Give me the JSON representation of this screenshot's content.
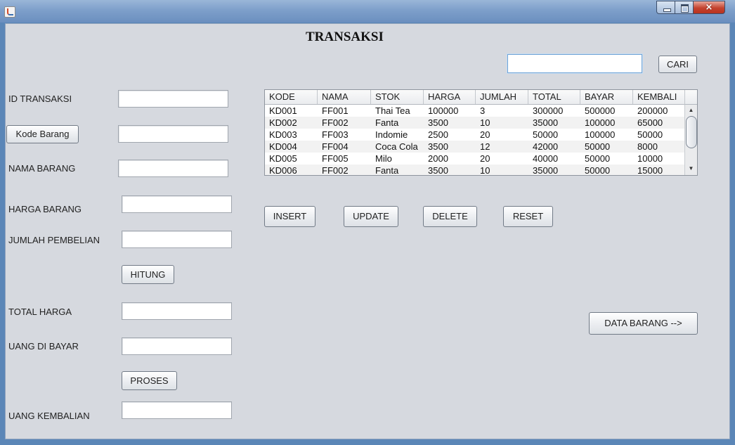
{
  "window": {
    "title": "",
    "close_glyph": "×"
  },
  "page": {
    "title": "TRANSAKSI"
  },
  "search": {
    "value": "",
    "button_label": "CARI"
  },
  "form": {
    "id_transaksi_label": "ID TRANSAKSI",
    "kode_barang_button": "Kode Barang",
    "nama_barang_label": "NAMA BARANG",
    "harga_barang_label": "HARGA BARANG",
    "jumlah_pembelian_label": "JUMLAH PEMBELIAN",
    "hitung_button": "HITUNG",
    "total_harga_label": "TOTAL HARGA",
    "uang_di_bayar_label": "UANG DI BAYAR",
    "proses_button": "PROSES",
    "uang_kembalian_label": "UANG KEMBALIAN"
  },
  "table": {
    "columns": [
      "KODE",
      "NAMA",
      "STOK",
      "HARGA",
      "JUMLAH",
      "TOTAL",
      "BAYAR",
      "KEMBALI"
    ],
    "rows": [
      [
        "KD001",
        "FF001",
        "Thai Tea",
        "100000",
        "3",
        "300000",
        "500000",
        "200000"
      ],
      [
        "KD002",
        "FF002",
        "Fanta",
        "3500",
        "10",
        "35000",
        "100000",
        "65000"
      ],
      [
        "KD003",
        "FF003",
        "Indomie",
        "2500",
        "20",
        "50000",
        "100000",
        "50000"
      ],
      [
        "KD004",
        "FF004",
        "Coca Cola",
        "3500",
        "12",
        "42000",
        "50000",
        "8000"
      ],
      [
        "KD005",
        "FF005",
        "Milo",
        "2000",
        "20",
        "40000",
        "50000",
        "10000"
      ],
      [
        "KD006",
        "FF002",
        "Fanta",
        "3500",
        "10",
        "35000",
        "50000",
        "15000"
      ]
    ],
    "scroll_up_glyph": "▲",
    "scroll_down_glyph": "▼"
  },
  "actions": {
    "insert": "INSERT",
    "update": "UPDATE",
    "delete": "DELETE",
    "reset": "RESET",
    "data_barang": "DATA BARANG -->"
  }
}
